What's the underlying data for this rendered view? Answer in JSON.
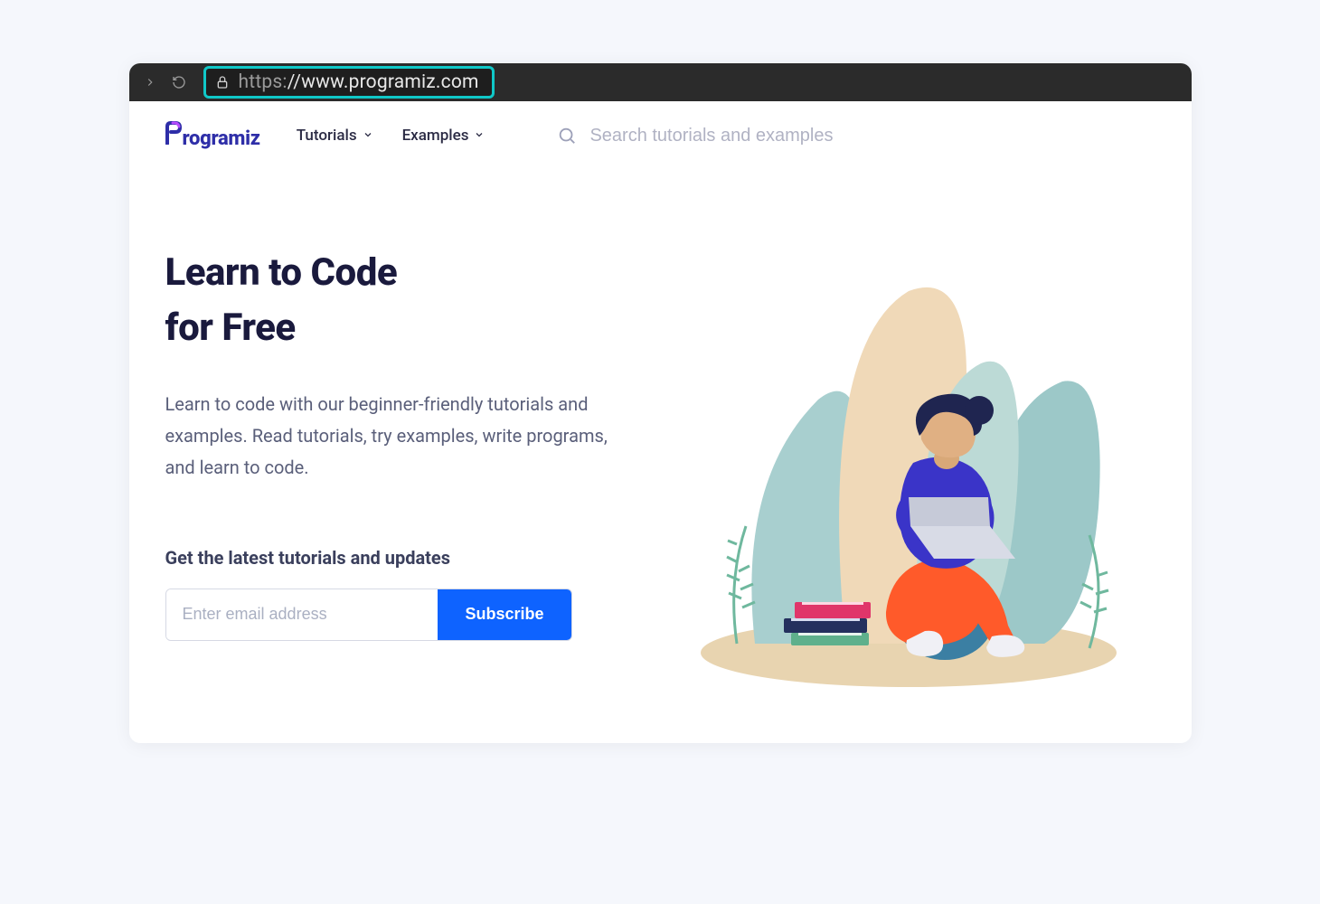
{
  "browser": {
    "url_proto": "https:",
    "url_rest": "//www.programiz.com"
  },
  "header": {
    "logo_text": "rogramiz",
    "nav": [
      {
        "label": "Tutorials"
      },
      {
        "label": "Examples"
      }
    ],
    "search_placeholder": "Search tutorials and examples"
  },
  "hero": {
    "title_line1": "Learn to Code",
    "title_line2": "for Free",
    "description": "Learn to code with our beginner-friendly tutorials and examples. Read tutorials, try examples, write programs, and learn to code.",
    "signup_label": "Get the latest tutorials and updates",
    "email_placeholder": "Enter email address",
    "subscribe_label": "Subscribe"
  },
  "colors": {
    "accent": "#0e63ff",
    "url_highlight": "#10c8c8",
    "heading": "#1a1a3d"
  }
}
